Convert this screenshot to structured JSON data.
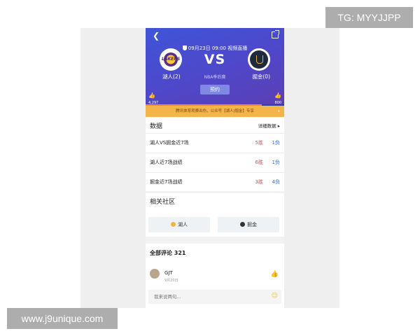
{
  "header": {
    "back_icon": "chevron-left-icon",
    "share_icon": "share-icon",
    "match_info": "09月23日 09:00 视频直播",
    "vs_text": "VS",
    "home_team": {
      "name": "湖人(2)",
      "logo_text": "LAKERS"
    },
    "away_team": {
      "name": "掘金(0)"
    },
    "status": "NBA季后赛",
    "book_button": "预约",
    "votes": {
      "home": "4,297",
      "away": "800",
      "home_fraction": 0.84
    }
  },
  "banner": {
    "text": "腾讯体育观赛出伤，公众号【湖人|掘金】专享"
  },
  "stats": {
    "title": "数据",
    "more_label": "详细数据",
    "rows": [
      {
        "label": "湖人VS掘金近7场",
        "wins": "5胜",
        "losses": "1负"
      },
      {
        "label": "湖人近7场战绩",
        "wins": "6胜",
        "losses": "1负"
      },
      {
        "label": "掘金近7场战绩",
        "wins": "3胜",
        "losses": "4负"
      }
    ]
  },
  "community": {
    "title": "相关社区",
    "items": [
      {
        "label": "湖人",
        "color": "#f2b53c"
      },
      {
        "label": "掘金",
        "color": "#333333"
      }
    ]
  },
  "comments": {
    "title": "全部评论 321",
    "first": {
      "user": "GJT",
      "date": "9月20日"
    },
    "input_placeholder": "我来说两句..."
  },
  "watermarks": {
    "top": "TG: MYYJJPP",
    "bottom": "www.j9unique.com"
  },
  "colors": {
    "header_start": "#3f55d8",
    "header_end": "#5b3fb4",
    "banner": "#f3b44a",
    "win": "#d34b4b",
    "loss": "#3d6bd1"
  }
}
